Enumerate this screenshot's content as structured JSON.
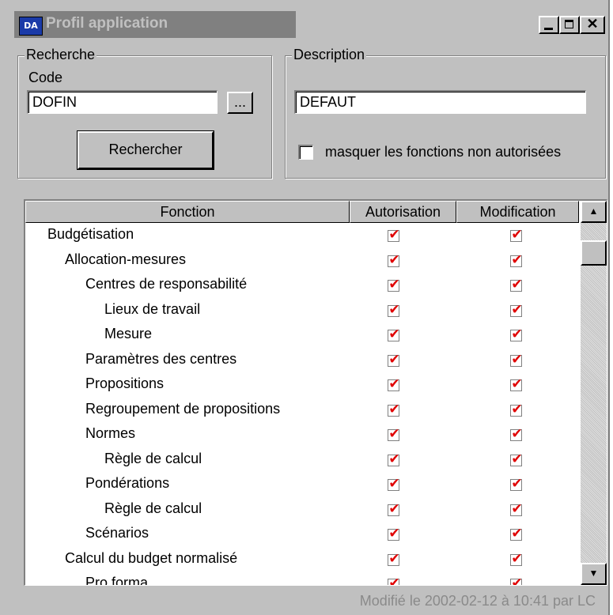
{
  "window": {
    "title": "Profil application",
    "icon": "app-logo-icon",
    "icon_text": "DA",
    "minimize_glyph": "_",
    "maximize_glyph": "□",
    "close_glyph": "✕"
  },
  "search": {
    "group_title": "Recherche",
    "code_label": "Code",
    "code_value": "DOFIN",
    "browse_label": "...",
    "search_button": "Rechercher"
  },
  "description": {
    "group_title": "Description",
    "value": "DEFAUT",
    "hide_checkbox_label": "masquer les fonctions non autorisées",
    "hide_checked": false
  },
  "table": {
    "columns": [
      "Fonction",
      "Autorisation",
      "Modification"
    ],
    "check_glyph": "✔",
    "check_color": "#e00000",
    "rows": [
      {
        "level": 0,
        "label": "Budgétisation",
        "auth": true,
        "modif": true
      },
      {
        "level": 1,
        "label": "Allocation-mesures",
        "auth": true,
        "modif": true
      },
      {
        "level": 2,
        "label": "Centres de responsabilité",
        "auth": true,
        "modif": true
      },
      {
        "level": 3,
        "label": "Lieux de travail",
        "auth": true,
        "modif": true
      },
      {
        "level": 3,
        "label": "Mesure",
        "auth": true,
        "modif": true
      },
      {
        "level": 2,
        "label": "Paramètres des centres",
        "auth": true,
        "modif": true
      },
      {
        "level": 2,
        "label": "Propositions",
        "auth": true,
        "modif": true
      },
      {
        "level": 2,
        "label": "Regroupement de propositions",
        "auth": true,
        "modif": true
      },
      {
        "level": 2,
        "label": "Normes",
        "auth": true,
        "modif": true
      },
      {
        "level": 3,
        "label": "Règle de calcul",
        "auth": true,
        "modif": true
      },
      {
        "level": 2,
        "label": "Pondérations",
        "auth": true,
        "modif": true
      },
      {
        "level": 3,
        "label": "Règle de calcul",
        "auth": true,
        "modif": true
      },
      {
        "level": 2,
        "label": "Scénarios",
        "auth": true,
        "modif": true
      },
      {
        "level": 1,
        "label": "Calcul du budget normalisé",
        "auth": true,
        "modif": true
      },
      {
        "level": 2,
        "label": "Pro forma",
        "auth": true,
        "modif": true
      }
    ]
  },
  "scrollbar": {
    "up_glyph": "▲",
    "down_glyph": "▼"
  },
  "status": "Modifié le 2002-02-12 à 10:41 par LC"
}
